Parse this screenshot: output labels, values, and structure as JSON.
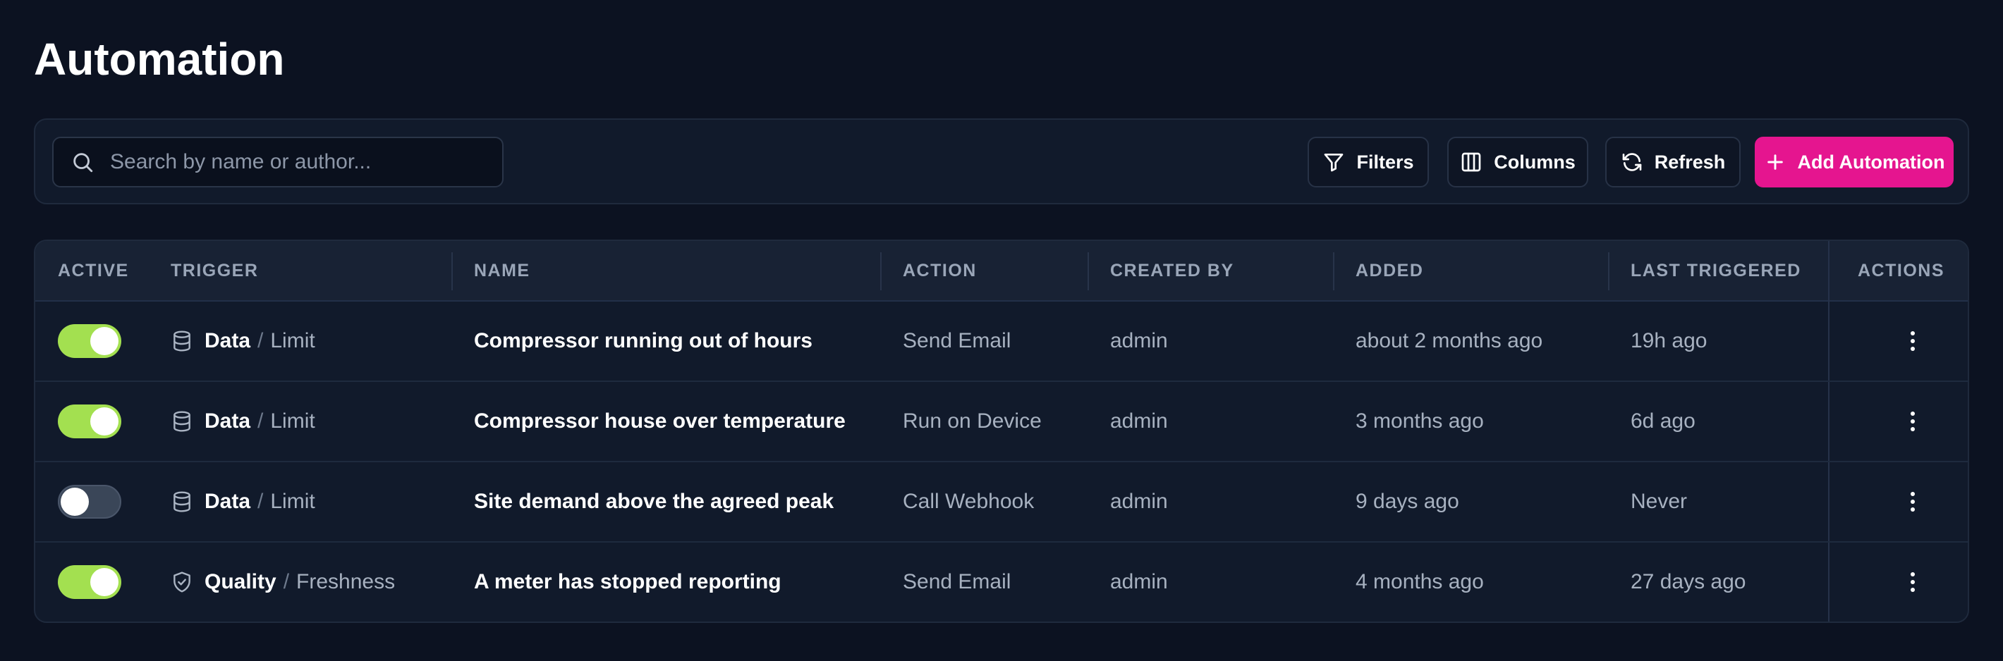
{
  "page": {
    "title": "Automation"
  },
  "toolbar": {
    "search_placeholder": "Search by name or author...",
    "filters_label": "Filters",
    "columns_label": "Columns",
    "refresh_label": "Refresh",
    "add_label": "Add Automation"
  },
  "colors": {
    "accent": "#e5158f",
    "toggle_on": "#a3e050",
    "background": "#0c1221"
  },
  "table": {
    "columns": {
      "active": "ACTIVE",
      "trigger": "TRIGGER",
      "name": "NAME",
      "action": "ACTION",
      "created_by": "CREATED BY",
      "added": "ADDED",
      "last_triggered": "LAST TRIGGERED",
      "actions": "ACTIONS"
    },
    "rows": [
      {
        "active": true,
        "trigger_icon": "database-icon",
        "trigger_type": "Data",
        "trigger_sub": "Limit",
        "name": "Compressor running out of hours",
        "action": "Send Email",
        "created_by": "admin",
        "added": "about 2 months ago",
        "last_triggered": "19h ago"
      },
      {
        "active": true,
        "trigger_icon": "database-icon",
        "trigger_type": "Data",
        "trigger_sub": "Limit",
        "name": "Compressor house over temperature",
        "action": "Run on Device",
        "created_by": "admin",
        "added": "3 months ago",
        "last_triggered": "6d ago"
      },
      {
        "active": false,
        "trigger_icon": "database-icon",
        "trigger_type": "Data",
        "trigger_sub": "Limit",
        "name": "Site demand above the agreed peak",
        "action": "Call Webhook",
        "created_by": "admin",
        "added": "9 days ago",
        "last_triggered": "Never"
      },
      {
        "active": true,
        "trigger_icon": "shield-check-icon",
        "trigger_type": "Quality",
        "trigger_sub": "Freshness",
        "name": "A meter has stopped reporting",
        "action": "Send Email",
        "created_by": "admin",
        "added": "4 months ago",
        "last_triggered": "27 days ago"
      }
    ]
  }
}
